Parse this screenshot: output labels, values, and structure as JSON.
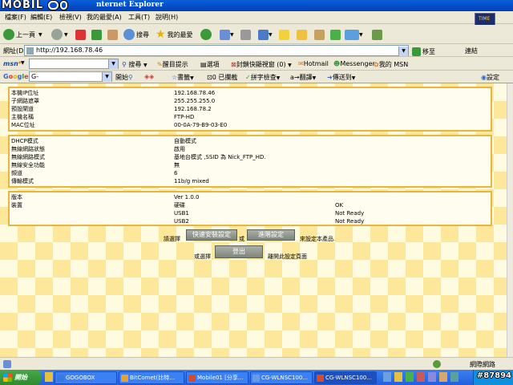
{
  "window": {
    "title": "nternet Explorer",
    "watermark": "MOBIL 01"
  },
  "menu": [
    "檔案(F)",
    "編輯(E)",
    "檢視(V)",
    "我的最愛(A)",
    "工具(T)",
    "說明(H)"
  ],
  "toolbar": {
    "back": "上一頁",
    "search": "搜尋",
    "favorites": "我的最愛"
  },
  "address": {
    "label": "網址(D)",
    "url": "http://192.168.78.46",
    "go": "移至",
    "links": "連結"
  },
  "msn": {
    "search": "搜尋",
    "highlight": "醒目提示",
    "options": "選項",
    "popup_blocked": "封鎖快顯視窗 (0)",
    "hotmail": "Hotmail",
    "messenger": "Messenger",
    "mymsn": "我的 MSN"
  },
  "google": {
    "search_field": "G-",
    "start": "開始",
    "bookmarks": "書籤",
    "blocked": "0 已攔截",
    "spell": "拼字檢查",
    "translate": "翻譯",
    "send": "傳送到",
    "settings": "設定"
  },
  "network_info": [
    {
      "key": "本機IP位址",
      "value": "192.168.78.46"
    },
    {
      "key": "子網路遮罩",
      "value": "255.255.255.0"
    },
    {
      "key": "預設閘道",
      "value": "192.168.78.2"
    },
    {
      "key": "主機名稱",
      "value": "FTP-HD"
    },
    {
      "key": "MAC位址",
      "value": "00-0A-79-B9-03-E0"
    }
  ],
  "wireless_info": [
    {
      "key": "DHCP模式",
      "value": "自動模式"
    },
    {
      "key": "無線網路狀態",
      "value": "啟用"
    },
    {
      "key": "無線網路模式",
      "value": "基地台模式 ,SSID 為 Nick_FTP_HD."
    },
    {
      "key": "無線安全功能",
      "value": "無"
    },
    {
      "key": "頻道",
      "value": "6"
    },
    {
      "key": "傳輸模式",
      "value": "11b/g mixed"
    }
  ],
  "version_info": {
    "version_label": "版本",
    "version_value": "Ver 1.0.0",
    "device_label": "裝置",
    "devices": [
      {
        "name": "硬碟",
        "status": "OK"
      },
      {
        "name": "USB1",
        "status": "Not Ready"
      },
      {
        "name": "USB2",
        "status": "Not Ready"
      }
    ]
  },
  "actions": {
    "prefix": "請選擇",
    "quick_setup": "快速安裝設定",
    "or": "或",
    "advanced": "進階設定",
    "suffix": "來設定本產品.",
    "or_choose": "或選擇",
    "logout": "登出",
    "leave": "離開此設定頁面"
  },
  "status": {
    "zone": "網際網路"
  },
  "taskbar": {
    "start": "開始",
    "tasks": [
      "GOGOBOX",
      "BitComet(比特...",
      "Mobile01 [分享...",
      "CG-WLNSC100...",
      "CG-WLNSC100..."
    ],
    "forum_id": "#87894"
  }
}
